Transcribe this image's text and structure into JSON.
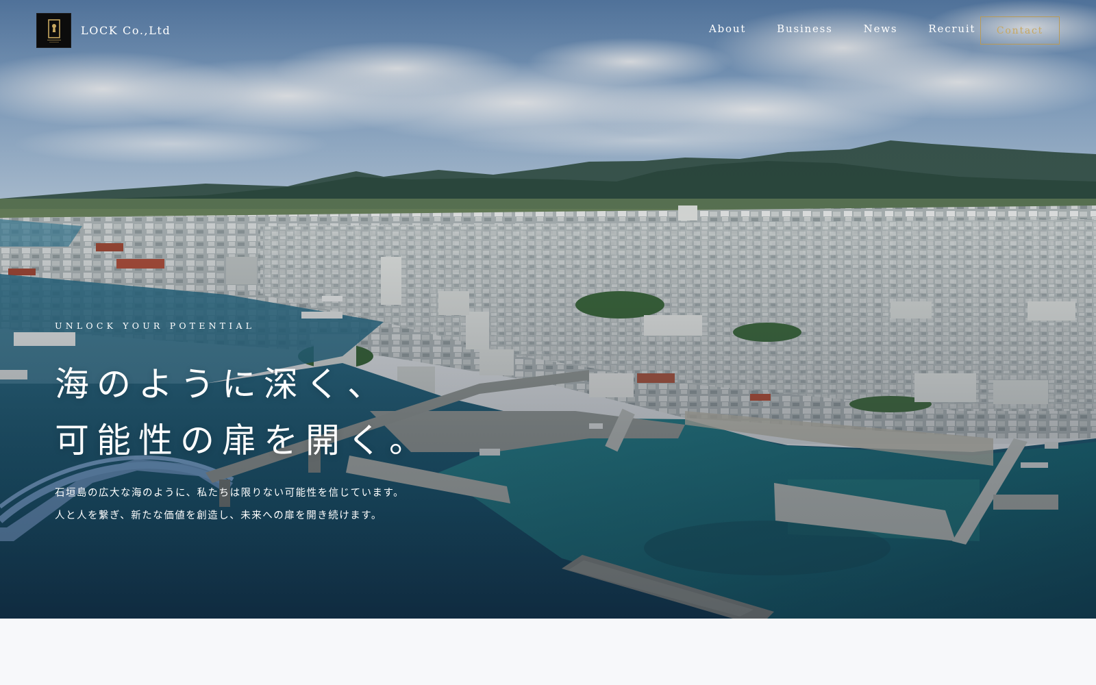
{
  "header": {
    "brand_name": "LOCK Co.,Ltd",
    "brand_icon": "keyhole-icon",
    "nav": [
      {
        "label": "About"
      },
      {
        "label": "Business"
      },
      {
        "label": "News"
      },
      {
        "label": "Recruit"
      }
    ],
    "contact_label": "Contact"
  },
  "hero": {
    "background": "aerial-harbor-city-photo",
    "eyebrow": "UNLOCK YOUR POTENTIAL",
    "headline": [
      "海のように深く、",
      "可能性の扉を開く。"
    ],
    "lead": [
      "石垣島の広大な海のように、私たちは限りない可能性を信じています。",
      "人と人を繋ぎ、新たな価値を創造し、未来への扉を開き続けます。"
    ]
  },
  "colors": {
    "accent_gold": "#c7a760",
    "logo_bg": "#0c0c0c",
    "text_on_hero": "#ffffff",
    "section_bg": "#f7f8fa"
  }
}
